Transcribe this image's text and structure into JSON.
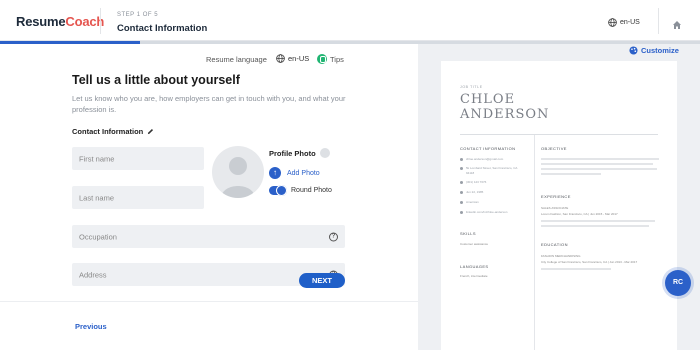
{
  "header": {
    "logo_part1": "Resume",
    "logo_part2": "Coach",
    "step": "STEP 1 OF 5",
    "title": "Contact Information",
    "language": "en-US",
    "progress_fraction": 0.2
  },
  "toolbar": {
    "resume_language_label": "Resume language",
    "language": "en-US",
    "tips": "Tips"
  },
  "form": {
    "heading": "Tell us a little about yourself",
    "intro": "Let us know who you are, how employers can get in touch with you, and what your profession is.",
    "section_label": "Contact Information",
    "first_name_placeholder": "First name",
    "last_name_placeholder": "Last name",
    "occupation_placeholder": "Occupation",
    "address_placeholder": "Address",
    "profile_photo": "Profile Photo",
    "add_photo": "Add Photo",
    "round_photo": "Round Photo",
    "round_photo_on": true
  },
  "footer": {
    "previous": "Previous",
    "next": "NEXT"
  },
  "preview": {
    "customize": "Customize",
    "job_title_label": "JOB TITLE",
    "first_name": "CHLOE",
    "last_name": "ANDERSON",
    "contact_heading": "CONTACT INFORMATION",
    "contact_lines": [
      "chloe.anderson@gmail.com",
      "5k Lombard Street, San Francisco, CA",
      "94118",
      "(301) 123 7676",
      "Jun 22, 1985",
      "American",
      "linkedin.com/in/chloe-anderson"
    ],
    "skills_heading": "SKILLS",
    "skills_item": "Customer assistance",
    "languages_heading": "LANGUAGES",
    "languages_item": "French, intermediate",
    "objective_heading": "OBJECTIVE",
    "experience_heading": "EXPERIENCE",
    "experience_title": "SALES ASSOCIATE",
    "experience_company": "Lorem Fashion, San Francisco, CA | Jun 2015 - Mar 2017",
    "education_heading": "EDUCATION",
    "education_title": "FASHION MERCHANDISING",
    "education_school": "City College of San Francisco, San Francisco, CA | Jun 2013 - Mar 2017"
  },
  "assistant_badge": "RC",
  "colors": {
    "brand_blue": "#2b60c9",
    "logo_dark": "#1d2a3a",
    "logo_accent": "#e5554f",
    "tips_green": "#21b573",
    "field_bg": "#eef0f3"
  }
}
